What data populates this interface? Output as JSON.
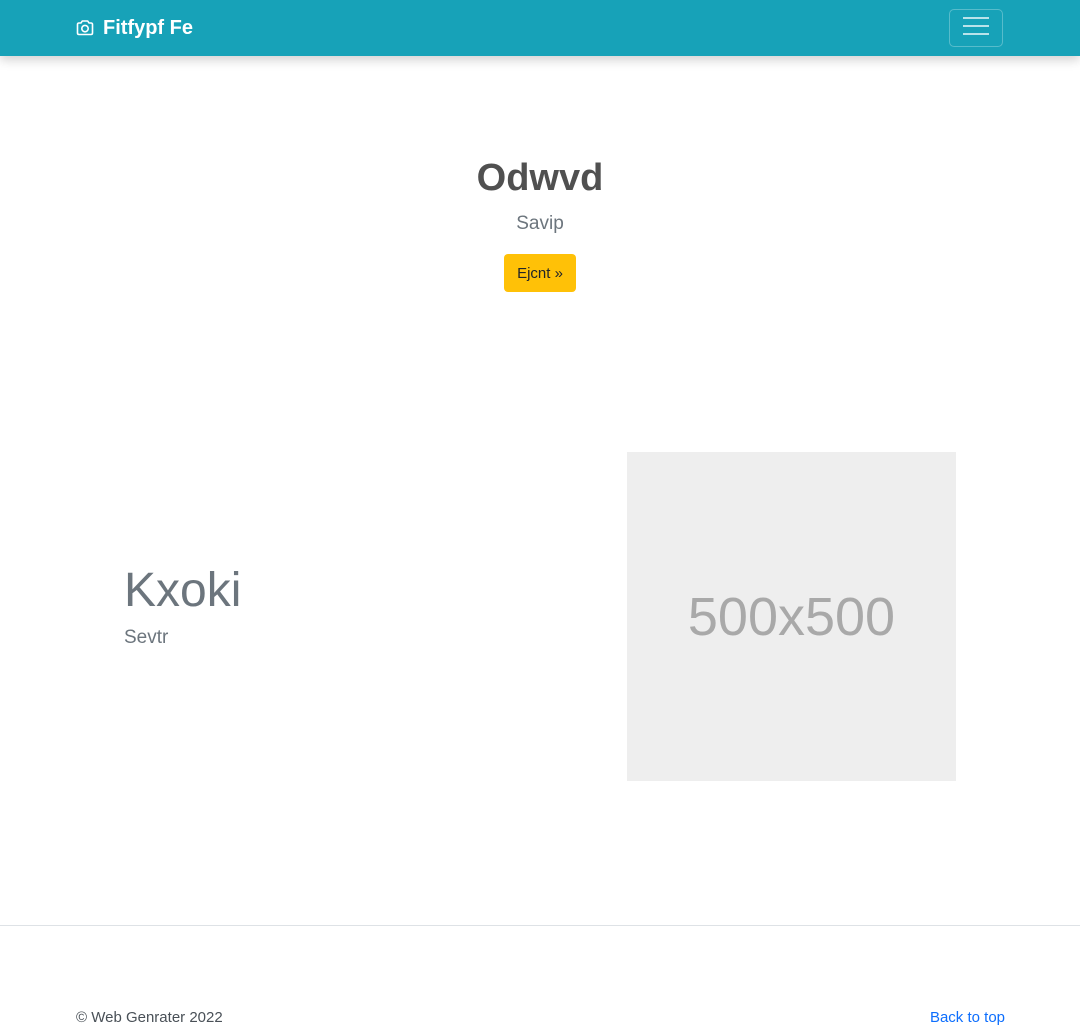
{
  "navbar": {
    "brand": "Fitfypf Fe",
    "brand_icon": "camera-icon",
    "menu_icon": "hamburger-icon",
    "background": "#17a2b8"
  },
  "hero": {
    "title": "Odwvd",
    "subtitle": "Savip",
    "button_label": "Ejcnt »",
    "button_color": "#ffc107"
  },
  "feature": {
    "title": "Kxoki",
    "subtitle": "Sevtr",
    "image_placeholder": "500x500"
  },
  "footer": {
    "copyright": "© Web Genrater 2022",
    "back_to_top": "Back to top"
  }
}
